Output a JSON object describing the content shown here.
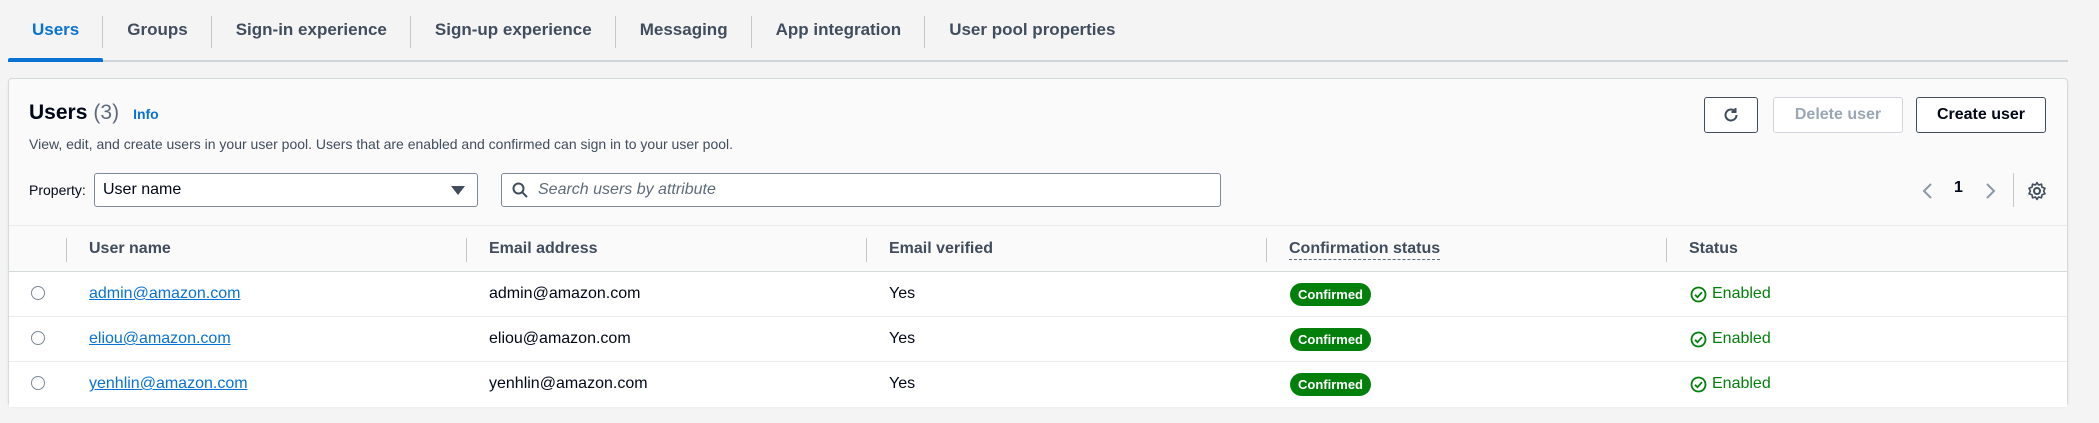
{
  "tabs": [
    {
      "label": "Users",
      "active": true
    },
    {
      "label": "Groups",
      "active": false
    },
    {
      "label": "Sign-in experience",
      "active": false
    },
    {
      "label": "Sign-up experience",
      "active": false
    },
    {
      "label": "Messaging",
      "active": false
    },
    {
      "label": "App integration",
      "active": false
    },
    {
      "label": "User pool properties",
      "active": false
    }
  ],
  "users_panel": {
    "title": "Users",
    "count": "(3)",
    "info_label": "Info",
    "description": "View, edit, and create users in your user pool. Users that are enabled and confirmed can sign in to your user pool.",
    "delete_label": "Delete user",
    "create_label": "Create user",
    "refresh_icon": "refresh-icon"
  },
  "filter": {
    "property_label": "Property:",
    "property_value": "User name",
    "search_placeholder": "Search users by attribute"
  },
  "pagination": {
    "current_page": "1"
  },
  "table": {
    "columns": [
      "User name",
      "Email address",
      "Email verified",
      "Confirmation status",
      "Status"
    ],
    "rows": [
      {
        "username": "admin@amazon.com",
        "email": "admin@amazon.com",
        "verified": "Yes",
        "confirmation": "Confirmed",
        "status": "Enabled"
      },
      {
        "username": "eliou@amazon.com",
        "email": "eliou@amazon.com",
        "verified": "Yes",
        "confirmation": "Confirmed",
        "status": "Enabled"
      },
      {
        "username": "yenhlin@amazon.com",
        "email": "yenhlin@amazon.com",
        "verified": "Yes",
        "confirmation": "Confirmed",
        "status": "Enabled"
      }
    ]
  },
  "colors": {
    "accent": "#0972d3",
    "success": "#037f0c",
    "text": "#000716"
  }
}
